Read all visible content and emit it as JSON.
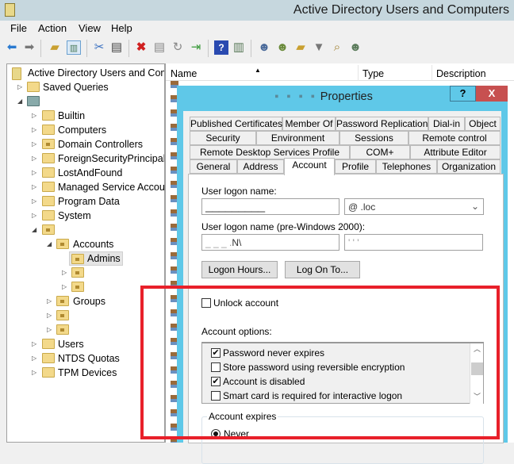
{
  "app": {
    "title": "Active Directory Users and Computers"
  },
  "menu": [
    "File",
    "Action",
    "View",
    "Help"
  ],
  "toolbar": [
    "back-icon",
    "forward-icon",
    "up-folder-icon",
    "show-hide-console-tree-icon",
    "cut-icon",
    "paste-icon",
    "delete-icon",
    "properties-icon",
    "refresh-icon",
    "export-list-icon",
    "help-icon",
    "action-pane-icon",
    "new-user-icon",
    "new-group-icon",
    "new-ou-icon",
    "filter-icon",
    "find-icon",
    "add-to-group-icon"
  ],
  "tree": {
    "root": "Active Directory Users and Com",
    "saved_queries": "Saved Queries",
    "items": [
      "Builtin",
      "Computers",
      "Domain Controllers",
      "ForeignSecurityPrincipals",
      "LostAndFound",
      "Managed Service Accoun",
      "Program Data",
      "System"
    ],
    "accounts": "Accounts",
    "admins": "Admins",
    "groups": "Groups",
    "bottom": [
      "Users",
      "NTDS Quotas",
      "TPM Devices"
    ]
  },
  "list": {
    "columns": [
      "Name",
      "Type",
      "Description"
    ]
  },
  "dialog": {
    "title": "Properties",
    "help": "?",
    "close": "X",
    "tabs_row1": [
      "Published Certificates",
      "Member Of",
      "Password Replication",
      "Dial-in",
      "Object"
    ],
    "tabs_row2": [
      "Security",
      "Environment",
      "Sessions",
      "Remote control"
    ],
    "tabs_row3": [
      "Remote Desktop Services Profile",
      "COM+",
      "Attribute Editor"
    ],
    "tabs_row4": [
      "General",
      "Address",
      "Account",
      "Profile",
      "Telephones",
      "Organization"
    ],
    "user_logon_label": "User logon name:",
    "domain_suffix": "@      .loc",
    "pre2000_label": "User logon name (pre-Windows 2000):",
    "pre2000_domain": "N\\",
    "logon_hours": "Logon Hours...",
    "log_on_to": "Log On To...",
    "unlock": "Unlock account",
    "options_label": "Account options:",
    "options": [
      {
        "label": "Password never expires",
        "checked": true
      },
      {
        "label": "Store password using reversible encryption",
        "checked": false
      },
      {
        "label": "Account is disabled",
        "checked": true
      },
      {
        "label": "Smart card is required for interactive logon",
        "checked": false
      }
    ],
    "expires_label": "Account expires",
    "never": "Never"
  }
}
